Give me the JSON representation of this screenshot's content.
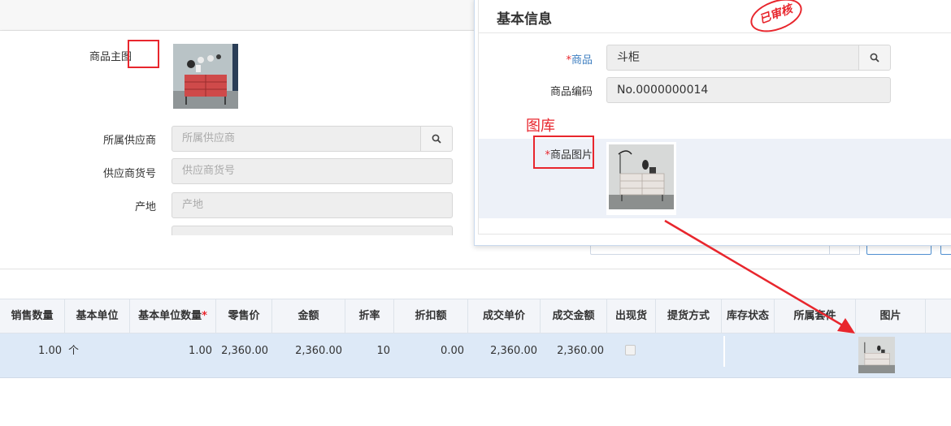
{
  "left_form": {
    "main_image_label": "商品主图",
    "supplier_label": "所属供应商",
    "supplier_placeholder": "所属供应商",
    "supplier_code_label": "供应商货号",
    "supplier_code_placeholder": "供应商货号",
    "origin_label": "产地",
    "origin_placeholder": "产地"
  },
  "dialog": {
    "title": "基本信息",
    "stamp_text": "已审核",
    "product_label": "商品",
    "product_value": "斗柜",
    "product_code_label": "商品编码",
    "product_code_value": "No.0000000014",
    "gallery_annotation": "图库",
    "product_image_label": "商品图片"
  },
  "table": {
    "headers": [
      "销售数量",
      "基本单位",
      "基本单位数量",
      "零售价",
      "金额",
      "折率",
      "折扣额",
      "成交单价",
      "成交金额",
      "出现货",
      "提货方式",
      "库存状态",
      "所属套件",
      "图片"
    ],
    "required_marker": "*",
    "row": {
      "qty": "1.00",
      "unit": "个",
      "base_qty": "1.00",
      "retail_price": "2,360.00",
      "amount": "2,360.00",
      "discount_rate": "10",
      "discount_amount": "0.00",
      "unit_price": "2,360.00",
      "total": "2,360.00"
    }
  },
  "colors": {
    "annotation_red": "#e8262d",
    "header_bg": "#f3f5f9",
    "row_selected_bg": "#dde9f7",
    "input_bg": "#eeeeee",
    "link_blue": "#3f7fc1"
  },
  "icons": [
    "search-icon",
    "arrow-annotation"
  ]
}
